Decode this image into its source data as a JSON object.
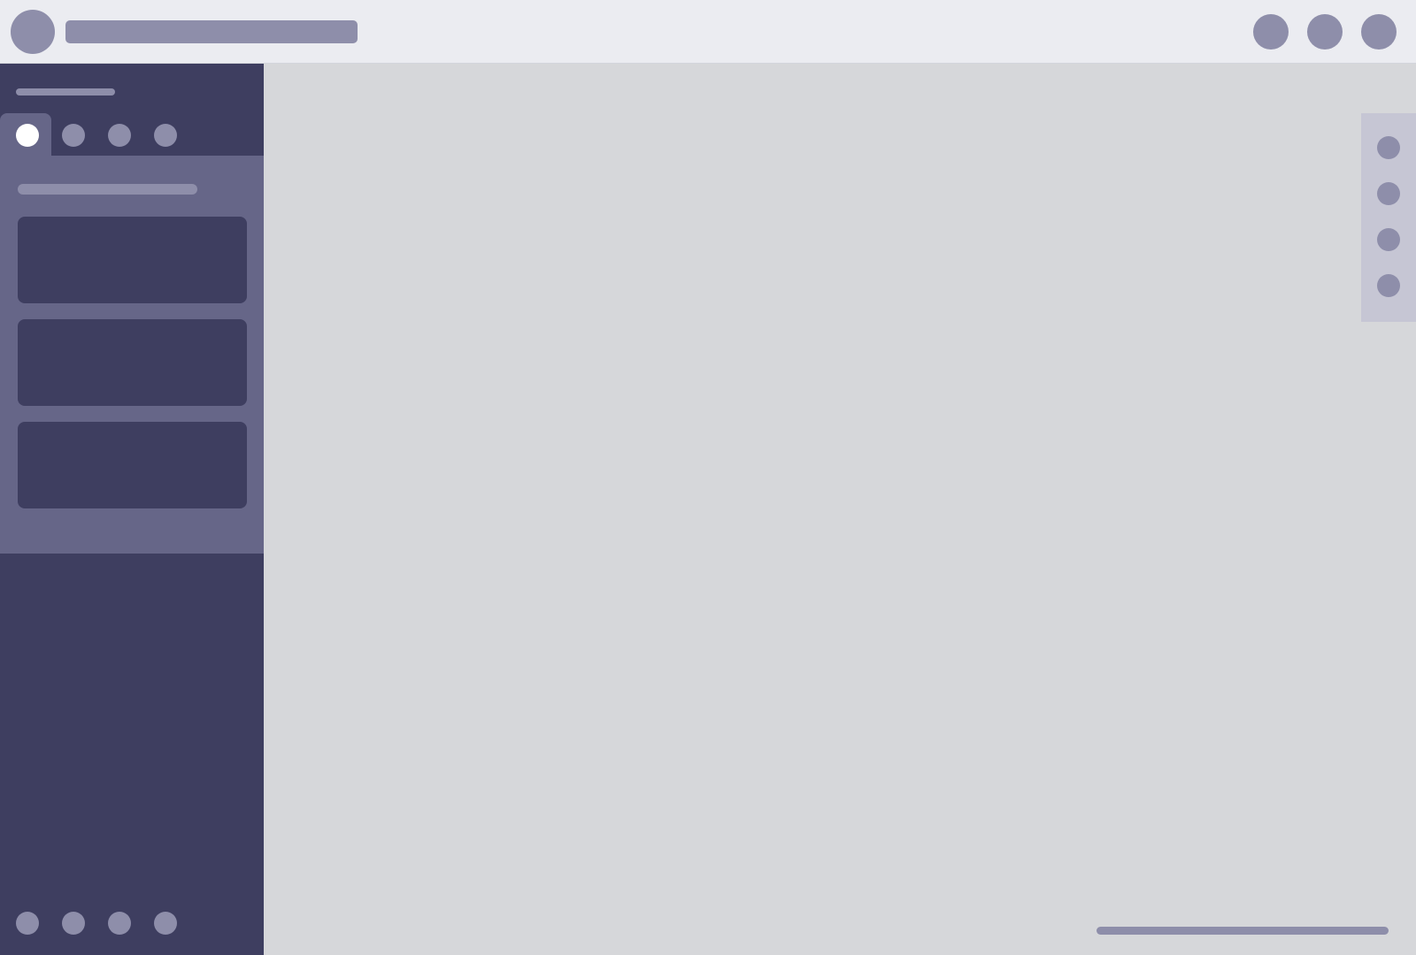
{
  "colors": {
    "topbar_bg": "#ebecf1",
    "sidebar_bg": "#3e3e60",
    "panel_bg": "#666688",
    "placeholder_gray": "#8e8eaa",
    "canvas_bg": "#d6d7da",
    "right_toolbar_bg": "#c6c6d4",
    "active_tab_icon": "#ffffff"
  },
  "topbar": {
    "actions": [
      "circle-icon",
      "circle-icon",
      "circle-icon"
    ]
  },
  "sidebar": {
    "tabs": [
      {
        "icon": "circle-icon",
        "active": true
      },
      {
        "icon": "circle-icon",
        "active": false
      },
      {
        "icon": "circle-icon",
        "active": false
      },
      {
        "icon": "circle-icon",
        "active": false
      }
    ],
    "cards_count": 3,
    "bottom_tools": [
      "circle-icon",
      "circle-icon",
      "circle-icon",
      "circle-icon"
    ]
  },
  "right_toolbar": {
    "tools": [
      "circle-icon",
      "circle-icon",
      "circle-icon",
      "circle-icon"
    ]
  }
}
